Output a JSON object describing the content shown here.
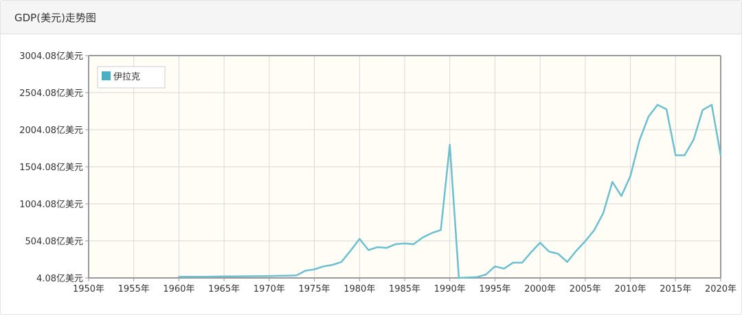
{
  "header": {
    "title": "GDP(美元)走势图"
  },
  "chart_data": {
    "type": "line",
    "title": "",
    "xlabel": "",
    "ylabel": "",
    "xlim": [
      1950,
      2020
    ],
    "ylim": [
      4.08,
      3004.08
    ],
    "x_ticks": [
      1950,
      1955,
      1960,
      1965,
      1970,
      1975,
      1980,
      1985,
      1990,
      1995,
      2000,
      2005,
      2010,
      2015,
      2020
    ],
    "x_tick_labels": [
      "1950年",
      "1955年",
      "1960年",
      "1965年",
      "1970年",
      "1975年",
      "1980年",
      "1985年",
      "1990年",
      "1995年",
      "2000年",
      "2005年",
      "2010年",
      "2015年",
      "2020年"
    ],
    "y_ticks": [
      4.08,
      504.08,
      1004.08,
      1504.08,
      2004.08,
      2504.08,
      3004.08
    ],
    "y_tick_labels": [
      "4.08亿美元",
      "504.08亿美元",
      "1004.08亿美元",
      "1504.08亿美元",
      "2004.08亿美元",
      "2504.08亿美元",
      "3004.08亿美元"
    ],
    "grid": true,
    "legend_position": "top-left",
    "colors": {
      "line": "#6bbfcf",
      "legend_swatch": "#4aafc2",
      "plot_bg": "#fffdf6",
      "grid": "#d8d8d8",
      "axis": "#999999"
    },
    "series": [
      {
        "name": "伊拉克",
        "x": [
          1960,
          1961,
          1962,
          1963,
          1964,
          1965,
          1966,
          1967,
          1968,
          1969,
          1970,
          1971,
          1972,
          1973,
          1974,
          1975,
          1976,
          1977,
          1978,
          1979,
          1980,
          1981,
          1982,
          1983,
          1984,
          1985,
          1986,
          1987,
          1988,
          1989,
          1990,
          1991,
          1992,
          1993,
          1994,
          1995,
          1996,
          1997,
          1998,
          1999,
          2000,
          2001,
          2002,
          2003,
          2004,
          2005,
          2006,
          2007,
          2008,
          2009,
          2010,
          2011,
          2012,
          2013,
          2014,
          2015,
          2016,
          2017,
          2018,
          2019,
          2020
        ],
        "values": [
          19,
          20,
          20,
          21,
          23,
          24,
          25,
          26,
          27,
          28,
          30,
          33,
          35,
          38,
          101,
          120,
          160,
          180,
          220,
          370,
          530,
          380,
          420,
          410,
          460,
          470,
          460,
          550,
          610,
          650,
          1800,
          4.08,
          10,
          15,
          50,
          160,
          130,
          210,
          210,
          350,
          480,
          360,
          330,
          220,
          370,
          500,
          650,
          880,
          1300,
          1110,
          1380,
          1860,
          2180,
          2340,
          2280,
          1660,
          1660,
          1870,
          2270,
          2340,
          1660
        ]
      }
    ]
  }
}
